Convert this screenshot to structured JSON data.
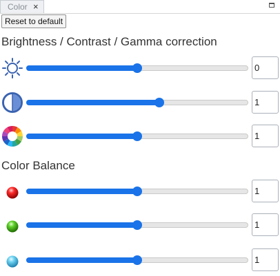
{
  "tab": {
    "label": "Color",
    "close_glyph": "×"
  },
  "toolbar": {
    "reset_label": "Reset to default"
  },
  "sections": {
    "brightness_title": "Brightness / Contrast / Gamma correction",
    "balance_title": "Color Balance"
  },
  "sliders": {
    "brightness": {
      "value": "0",
      "level": 0.5,
      "icon": "sun-icon"
    },
    "contrast": {
      "value": "1",
      "level": 0.6,
      "icon": "contrast-icon"
    },
    "gamma": {
      "value": "1",
      "level": 0.5,
      "icon": "color-wheel-icon"
    },
    "red": {
      "value": "1",
      "level": 0.5,
      "icon": "red-ball-icon"
    },
    "green": {
      "value": "1",
      "level": 0.5,
      "icon": "green-ball-icon"
    },
    "blue": {
      "value": "1",
      "level": 0.5,
      "icon": "blue-ball-icon"
    }
  },
  "colors": {
    "accent": "#1a73e8"
  }
}
